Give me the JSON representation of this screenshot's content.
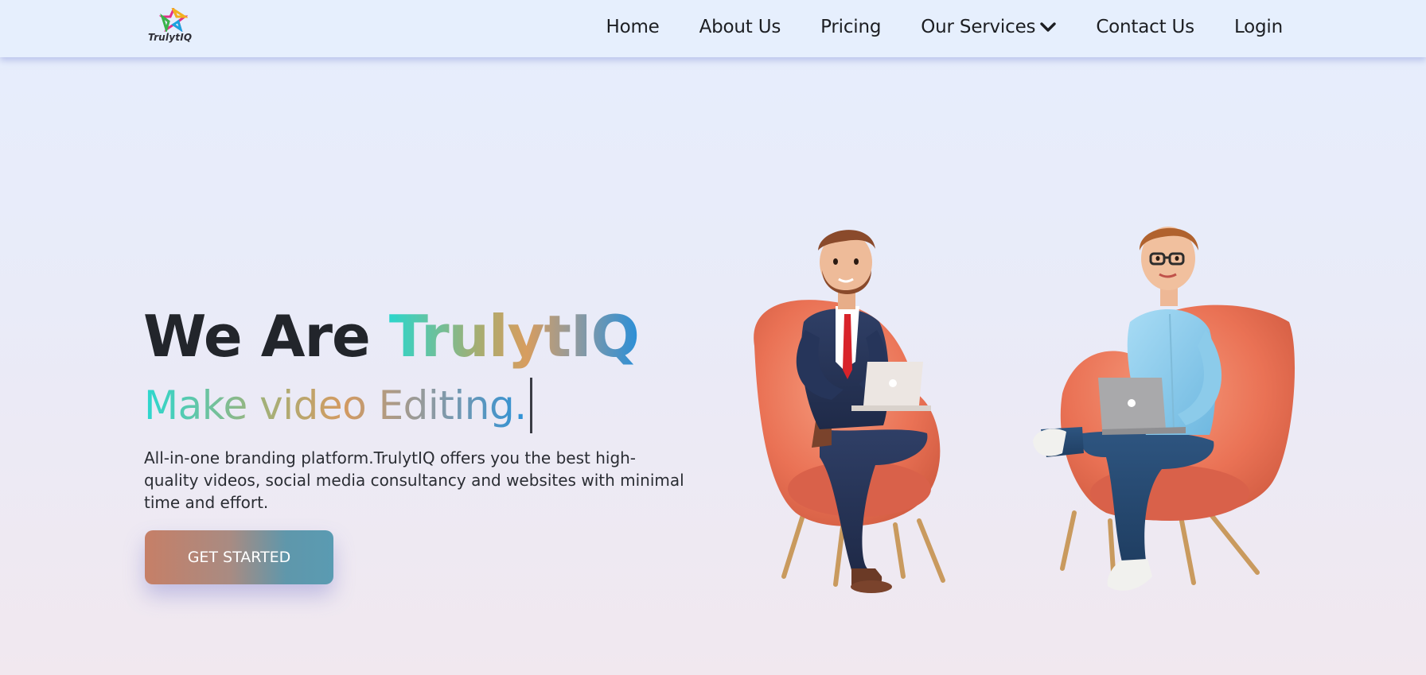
{
  "brand": {
    "logo_text": "TrulytIQ"
  },
  "nav": {
    "items": [
      {
        "label": "Home"
      },
      {
        "label": "About Us"
      },
      {
        "label": "Pricing"
      },
      {
        "label": "Our Services",
        "has_dropdown": true
      },
      {
        "label": "Contact Us"
      },
      {
        "label": "Login"
      }
    ]
  },
  "hero": {
    "title_prefix": "We Are ",
    "title_brand": "TrulytIQ",
    "subtitle": "Make video Editing.",
    "description": "All-in-one branding platform.TrulytIQ offers you the best high-quality videos, social media consultancy and websites with minimal time and effort.",
    "cta_label": "GET STARTED"
  },
  "icons": {
    "logo": "multicolor-star-logo-icon",
    "dropdown": "chevron-down-icon"
  },
  "colors": {
    "nav_bg": "#e6effd",
    "text_dark": "#22252b",
    "gradient_start": "#2bd6cc",
    "gradient_mid": "#d79d5f",
    "gradient_end": "#2a8fd8",
    "cta_start": "#c67f67",
    "cta_end": "#5a9bb2",
    "chair": "#ec7a5c"
  }
}
